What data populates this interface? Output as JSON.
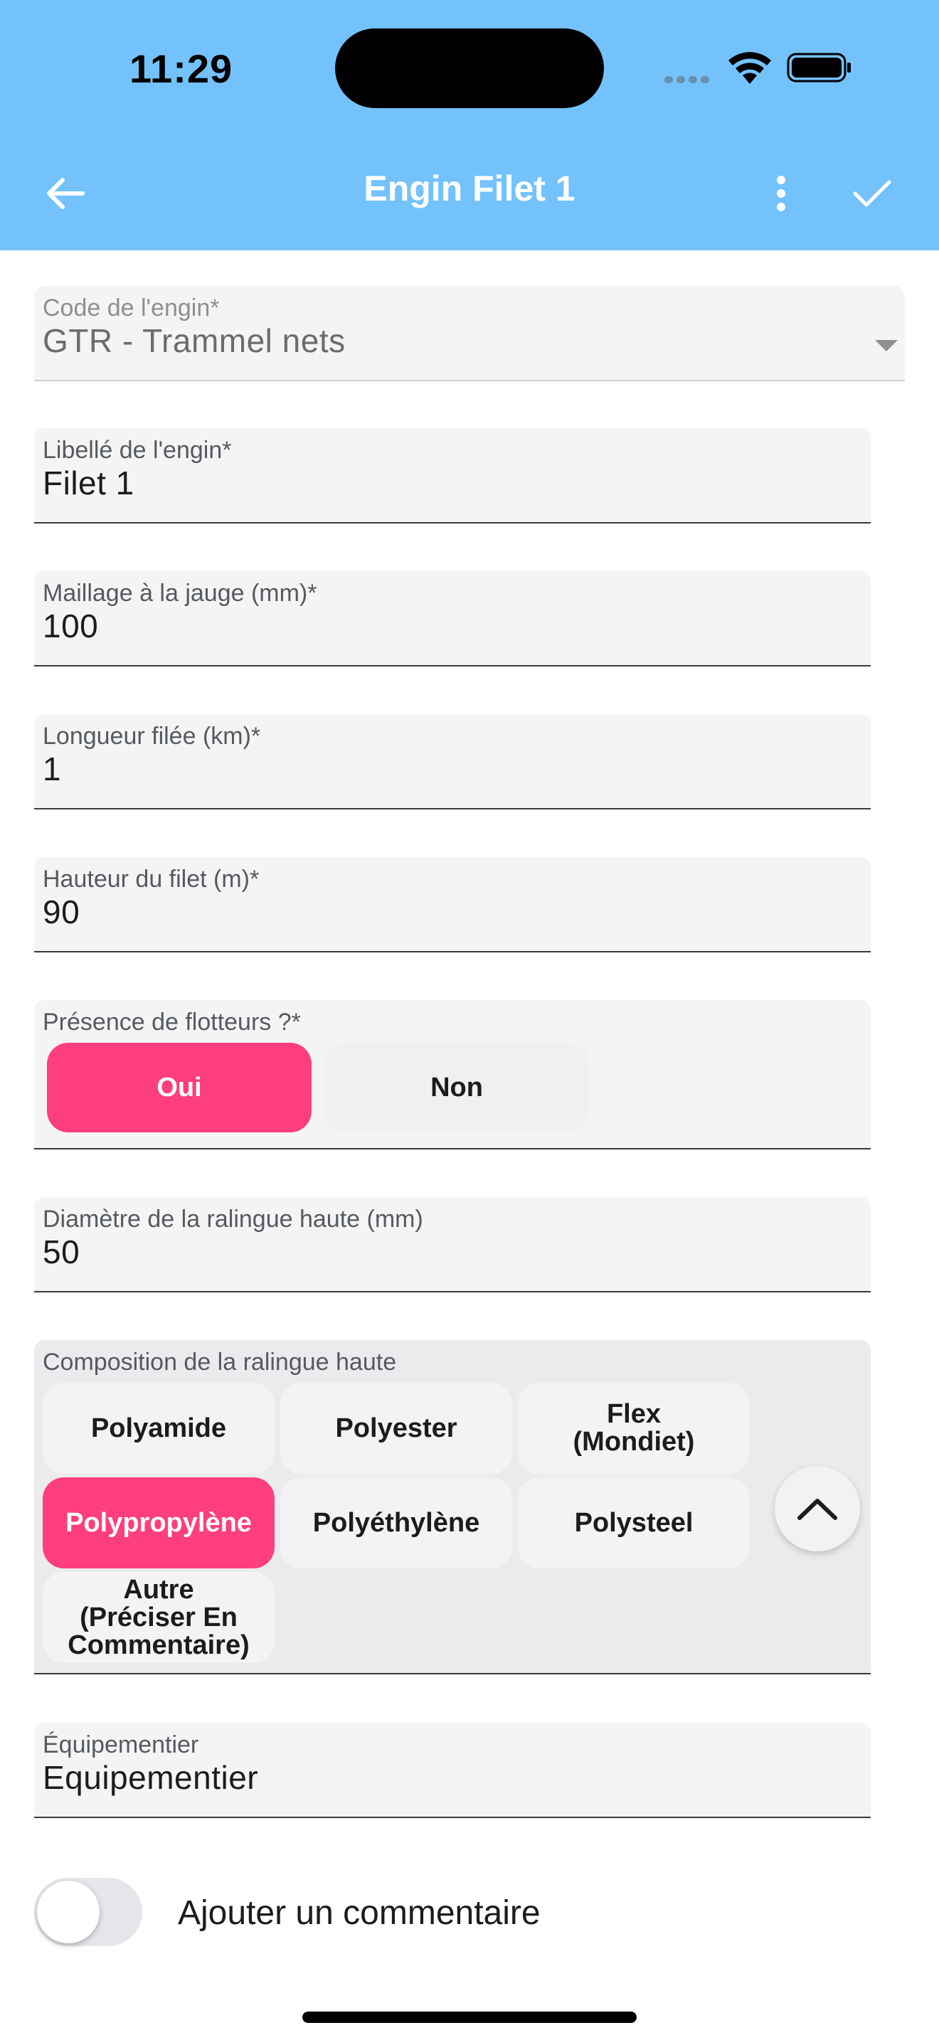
{
  "status_bar": {
    "time": "11:29"
  },
  "header": {
    "title": "Engin Filet 1",
    "back_icon": "arrow-left-icon",
    "more_icon": "more-vertical-icon",
    "confirm_icon": "check-icon",
    "background_color": "#74c2fb"
  },
  "form": {
    "code_engin": {
      "label": "Code de l'engin*",
      "value": "GTR - Trammel nets"
    },
    "libelle": {
      "label": "Libellé de l'engin*",
      "value": "Filet 1"
    },
    "maillage": {
      "label": "Maillage à la jauge (mm)*",
      "value": "100"
    },
    "longueur": {
      "label": "Longueur filée (km)*",
      "value": "1"
    },
    "hauteur": {
      "label": "Hauteur du filet (m)*",
      "value": "90"
    },
    "flotteurs": {
      "label": "Présence de flotteurs ?*",
      "options": [
        "Oui",
        "Non"
      ],
      "selected": "Oui"
    },
    "diametre": {
      "label": "Diamètre de la ralingue haute (mm)",
      "value": "50"
    },
    "composition": {
      "label": "Composition de la ralingue haute",
      "options": [
        "Polyamide",
        "Polyester",
        "Flex\n(Mondiet)",
        "Polypropylène",
        "Polyéthylène",
        "Polysteel",
        "Autre\n(Préciser En\nCommentaire)"
      ],
      "selected": "Polypropylène"
    },
    "equipementier": {
      "label": "Équipementier",
      "value": "Equipementier"
    },
    "commentaire_toggle": {
      "label": "Ajouter un commentaire",
      "on": false
    }
  },
  "colors": {
    "accent": "#fe3e7d",
    "field_bg": "#f4f4f5"
  }
}
